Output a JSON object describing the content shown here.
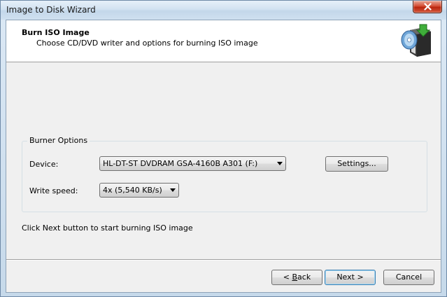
{
  "window": {
    "title": "Image to Disk Wizard"
  },
  "header": {
    "title": "Burn ISO Image",
    "subtitle": "Choose CD/DVD writer and options for burning ISO image",
    "icon": "computer-disk-burn-icon"
  },
  "burner_options": {
    "legend": "Burner Options",
    "device_label": "Device:",
    "device_value": "HL-DT-ST DVDRAM GSA-4160B A301  (F:)",
    "settings_button": "Settings...",
    "speed_label": "Write speed:",
    "speed_value": "4x (5,540 KB/s)"
  },
  "instruction": "Click Next button to start burning ISO image",
  "buttons": {
    "back_mnemonic": "B",
    "back_rest": "ack",
    "back_prefix": "< ",
    "next": "Next >",
    "cancel": "Cancel"
  },
  "colors": {
    "close_button": "#c7381d",
    "default_button_border": "#3c7fb1"
  }
}
